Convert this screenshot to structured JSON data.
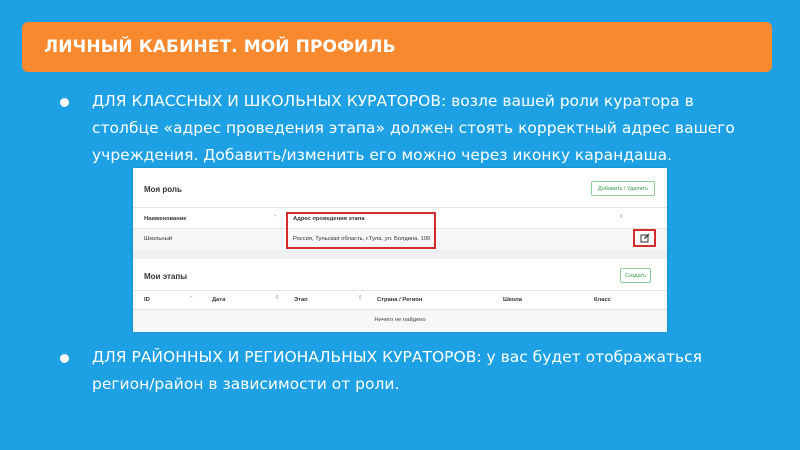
{
  "header": {
    "title": "ЛИЧНЫЙ КАБИНЕТ. МОЙ ПРОФИЛЬ"
  },
  "bullets": [
    {
      "text": "ДЛЯ КЛАССНЫХ И ШКОЛЬНЫХ КУРАТОРОВ: возле вашей роли куратора в столбце «адрес проведения этапа» должен стоять корректный адрес вашего учреждения. Добавить/изменить его можно через иконку карандаша."
    },
    {
      "text": "ДЛЯ РАЙОННЫХ И РЕГИОНАЛЬНЫХ КУРАТОРОВ: у вас будет отображаться регион/район в зависимости от роли."
    }
  ],
  "screenshot": {
    "roles_card": {
      "title": "Моя роль",
      "button_label": "Добавить / Удалить",
      "columns": [
        "Наименование",
        "Адрес проведения этапа"
      ],
      "rows": [
        {
          "name": "Школьный",
          "address": "Россия, Тульская область, г.Тула, ул. Болдина, 100"
        }
      ]
    },
    "stages_card": {
      "title": "Мои этапы",
      "button_label": "Создать",
      "columns": [
        "ID",
        "Дата",
        "Этап",
        "Страна / Регион",
        "Школа",
        "Класс"
      ],
      "empty_message": "Ничего не найдено"
    }
  },
  "colors": {
    "background": "#1ea0e4",
    "banner": "#f9892f",
    "highlight": "#d42b2b",
    "button_green": "#3a9a4b"
  },
  "icons": {
    "edit": "pencil-square-icon",
    "sort": "sort-arrows-icon",
    "bullet": "bullet-dot-icon"
  }
}
